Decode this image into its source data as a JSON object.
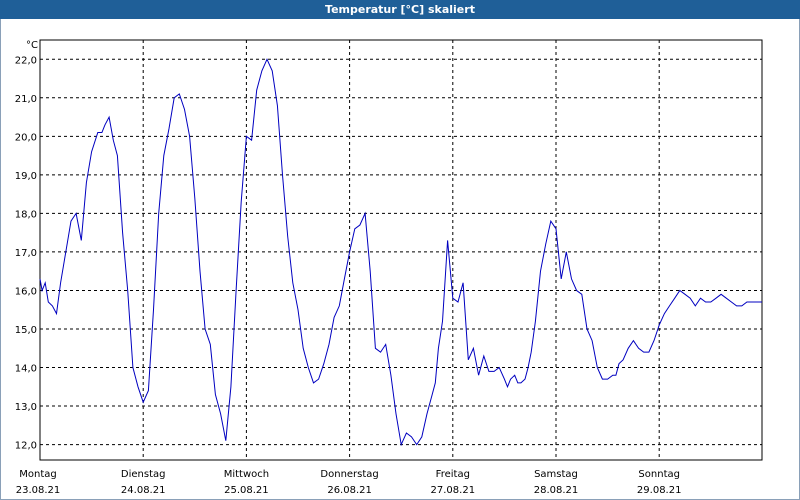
{
  "chart_data": {
    "type": "line",
    "title": "Temperatur [°C] skaliert",
    "yunit": "°C",
    "ylim": [
      11.6,
      22.5
    ],
    "yticks": [
      "22,0",
      "21,0",
      "20,0",
      "19,0",
      "18,0",
      "17,0",
      "16,0",
      "15,0",
      "14,0",
      "13,0",
      "12,0"
    ],
    "ytick_values": [
      22,
      21,
      20,
      19,
      18,
      17,
      16,
      15,
      14,
      13,
      12
    ],
    "days": [
      {
        "name": "Montag",
        "date": "23.08.21"
      },
      {
        "name": "Dienstag",
        "date": "24.08.21"
      },
      {
        "name": "Mittwoch",
        "date": "25.08.21"
      },
      {
        "name": "Donnerstag",
        "date": "26.08.21"
      },
      {
        "name": "Freitag",
        "date": "27.08.21"
      },
      {
        "name": "Samstag",
        "date": "28.08.21"
      },
      {
        "name": "Sonntag",
        "date": "29.08.21"
      }
    ],
    "grid": true,
    "line_color": "#0000c0",
    "series": [
      {
        "x": [
          0,
          0.02,
          0.05,
          0.08,
          0.12,
          0.16,
          0.2,
          0.25,
          0.3,
          0.35,
          0.4,
          0.45,
          0.5,
          0.56,
          0.6,
          0.63,
          0.67,
          0.71,
          0.75,
          0.8,
          0.85,
          0.9,
          0.95,
          1.0,
          1.05,
          1.1,
          1.15,
          1.2,
          1.25,
          1.3,
          1.35,
          1.4,
          1.45,
          1.5,
          1.55,
          1.6,
          1.65,
          1.7,
          1.75,
          1.8,
          1.85,
          1.9,
          1.95,
          2.0,
          2.05,
          2.1,
          2.15,
          2.2,
          2.25,
          2.3,
          2.35,
          2.4,
          2.45,
          2.5,
          2.55,
          2.6,
          2.65,
          2.7,
          2.75,
          2.8,
          2.85,
          2.9,
          2.95,
          3.0,
          3.05,
          3.1,
          3.15,
          3.2,
          3.25,
          3.3,
          3.35,
          3.4,
          3.45,
          3.5,
          3.55,
          3.6,
          3.65,
          3.7,
          3.75,
          3.8,
          3.83,
          3.86,
          3.9,
          3.95,
          4.0,
          4.05,
          4.1,
          4.15,
          4.2,
          4.25,
          4.3,
          4.35,
          4.4,
          4.45,
          4.5,
          4.53,
          4.56,
          4.6,
          4.63,
          4.66,
          4.7,
          4.73,
          4.76,
          4.8,
          4.85,
          4.9,
          4.95,
          5.0,
          5.05,
          5.1,
          5.15,
          5.2,
          5.25,
          5.3,
          5.35,
          5.4,
          5.45,
          5.5,
          5.55,
          5.58,
          5.61,
          5.65,
          5.7,
          5.75,
          5.8,
          5.85,
          5.9,
          5.95,
          6.0,
          6.05,
          6.1,
          6.15,
          6.2,
          6.25,
          6.3,
          6.35,
          6.4,
          6.45,
          6.5,
          6.55,
          6.6,
          6.65,
          6.7,
          6.75,
          6.8,
          6.85,
          6.9,
          6.95,
          7.0,
          7.03
        ],
        "y": [
          16.3,
          16.0,
          16.2,
          15.7,
          15.6,
          15.4,
          16.2,
          17.0,
          17.8,
          18.0,
          17.3,
          18.8,
          19.6,
          20.1,
          20.1,
          20.3,
          20.5,
          19.9,
          19.5,
          17.5,
          16.0,
          14.0,
          13.5,
          13.1,
          13.4,
          15.5,
          18.0,
          19.5,
          20.2,
          21.0,
          21.1,
          20.7,
          20.0,
          18.4,
          16.5,
          15.0,
          14.6,
          13.3,
          12.8,
          12.1,
          13.5,
          16.0,
          18.3,
          20.0,
          19.9,
          21.2,
          21.7,
          22.0,
          21.7,
          20.8,
          19.0,
          17.4,
          16.2,
          15.5,
          14.5,
          14.0,
          13.6,
          13.7,
          14.1,
          14.6,
          15.3,
          15.6,
          16.3,
          17.0,
          17.6,
          17.7,
          18.0,
          16.5,
          14.5,
          14.4,
          14.6,
          13.8,
          12.8,
          12.0,
          12.3,
          12.2,
          12.0,
          12.2,
          12.8,
          13.3,
          13.6,
          14.5,
          15.2,
          17.3,
          15.8,
          15.7,
          16.2,
          14.2,
          14.5,
          13.8,
          14.3,
          13.9,
          13.9,
          14.0,
          13.7,
          13.5,
          13.7,
          13.8,
          13.6,
          13.6,
          13.7,
          14.0,
          14.4,
          15.2,
          16.5,
          17.2,
          17.8,
          17.6,
          16.3,
          17.0,
          16.3,
          16.0,
          15.9,
          15.0,
          14.7,
          14.0,
          13.7,
          13.7,
          13.8,
          13.8,
          14.1,
          14.2,
          14.5,
          14.7,
          14.5,
          14.4,
          14.4,
          14.7,
          15.1,
          15.4,
          15.6,
          15.8,
          16.0,
          15.9,
          15.8,
          15.6,
          15.8,
          15.7,
          15.7,
          15.8,
          15.9,
          15.8,
          15.7,
          15.6,
          15.6,
          15.7,
          15.7,
          15.7,
          15.7,
          15.7
        ]
      }
    ]
  }
}
